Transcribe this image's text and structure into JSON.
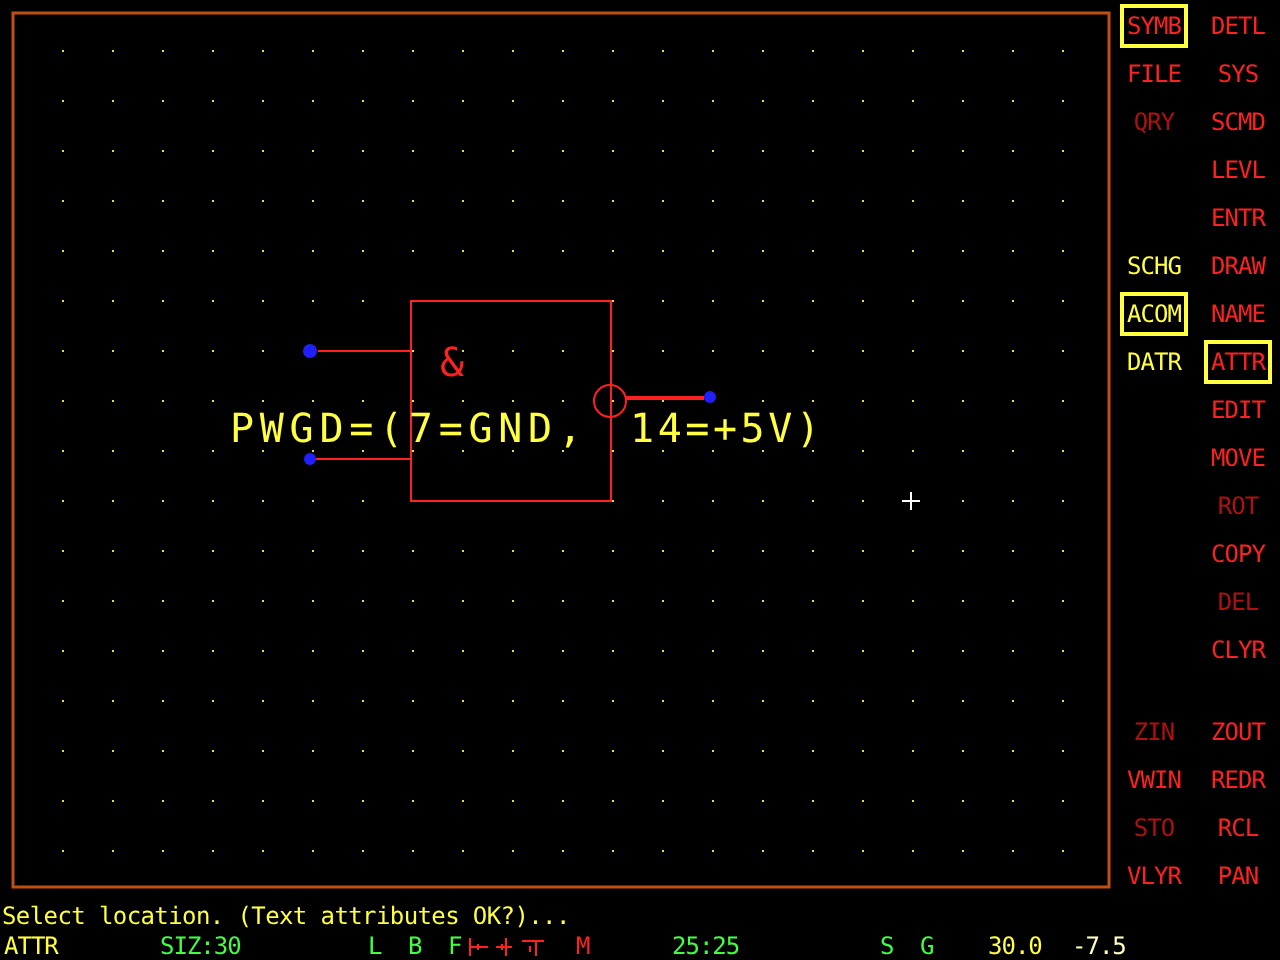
{
  "canvas": {
    "gate": {
      "symbol": "&",
      "attribute_text_parts": [
        "PWGD=(7=GND,",
        "14=+5V)"
      ]
    }
  },
  "menu_top": [
    {
      "left": {
        "label": "SYMB",
        "kind": "command",
        "selected": true,
        "disabled": false
      },
      "right": {
        "label": "DETL",
        "kind": "command",
        "selected": false,
        "disabled": false
      }
    },
    {
      "left": {
        "label": "FILE",
        "kind": "command",
        "selected": false,
        "disabled": false
      },
      "right": {
        "label": "SYS",
        "kind": "command",
        "selected": false,
        "disabled": false
      }
    },
    {
      "left": {
        "label": "QRY",
        "kind": "command",
        "selected": false,
        "disabled": true
      },
      "right": {
        "label": "SCMD",
        "kind": "command",
        "selected": false,
        "disabled": false
      }
    },
    {
      "right": {
        "label": "LEVL",
        "kind": "command",
        "selected": false,
        "disabled": false
      }
    },
    {
      "right": {
        "label": "ENTR",
        "kind": "command",
        "selected": false,
        "disabled": false
      }
    },
    {
      "left": {
        "label": "SCHG",
        "kind": "mode",
        "selected": false,
        "disabled": false
      },
      "right": {
        "label": "DRAW",
        "kind": "command",
        "selected": false,
        "disabled": false
      }
    },
    {
      "left": {
        "label": "ACOM",
        "kind": "mode",
        "selected": true,
        "disabled": false
      },
      "right": {
        "label": "NAME",
        "kind": "command",
        "selected": false,
        "disabled": false
      }
    },
    {
      "left": {
        "label": "DATR",
        "kind": "mode",
        "selected": false,
        "disabled": false
      },
      "right": {
        "label": "ATTR",
        "kind": "command",
        "selected": true,
        "disabled": false
      }
    },
    {
      "right": {
        "label": "EDIT",
        "kind": "command",
        "selected": false,
        "disabled": false
      }
    },
    {
      "right": {
        "label": "MOVE",
        "kind": "command",
        "selected": false,
        "disabled": false
      }
    },
    {
      "right": {
        "label": "ROT",
        "kind": "command",
        "selected": false,
        "disabled": true
      }
    },
    {
      "right": {
        "label": "COPY",
        "kind": "command",
        "selected": false,
        "disabled": false
      }
    },
    {
      "right": {
        "label": "DEL",
        "kind": "command",
        "selected": false,
        "disabled": true
      }
    },
    {
      "right": {
        "label": "CLYR",
        "kind": "command",
        "selected": false,
        "disabled": false
      }
    }
  ],
  "menu_bottom": [
    {
      "left": {
        "label": "ZIN",
        "kind": "command",
        "selected": false,
        "disabled": true
      },
      "right": {
        "label": "ZOUT",
        "kind": "command",
        "selected": false,
        "disabled": false
      }
    },
    {
      "left": {
        "label": "VWIN",
        "kind": "command",
        "selected": false,
        "disabled": false
      },
      "right": {
        "label": "REDR",
        "kind": "command",
        "selected": false,
        "disabled": false
      }
    },
    {
      "left": {
        "label": "STO",
        "kind": "command",
        "selected": false,
        "disabled": true
      },
      "right": {
        "label": "RCL",
        "kind": "command",
        "selected": false,
        "disabled": false
      }
    },
    {
      "left": {
        "label": "VLYR",
        "kind": "command",
        "selected": false,
        "disabled": false
      },
      "right": {
        "label": "PAN",
        "kind": "command",
        "selected": false,
        "disabled": false
      }
    }
  ],
  "prompt": "Select location. (Text attributes OK?)...",
  "status_bar": [
    {
      "kind": "text",
      "text": "ATTR",
      "color": "#ffff40"
    },
    {
      "kind": "text",
      "text": "SIZ:30",
      "color": "#40ff40"
    },
    {
      "kind": "text",
      "text": "L",
      "color": "#40ff40"
    },
    {
      "kind": "text",
      "text": "B",
      "color": "#40ff40"
    },
    {
      "kind": "text",
      "text": "F",
      "color": "#40ff40"
    },
    {
      "kind": "marks"
    },
    {
      "kind": "text",
      "text": "M",
      "color": "#ff2020"
    },
    {
      "kind": "text",
      "text": "25:25",
      "color": "#40ff40"
    },
    {
      "kind": "text",
      "text": "S",
      "color": "#40ff40"
    },
    {
      "kind": "text",
      "text": "G",
      "color": "#40ff40"
    },
    {
      "kind": "text",
      "text": "30.0",
      "color": "#ffff40"
    },
    {
      "kind": "text",
      "text": "-7.5",
      "color": "#ffffc0"
    }
  ]
}
